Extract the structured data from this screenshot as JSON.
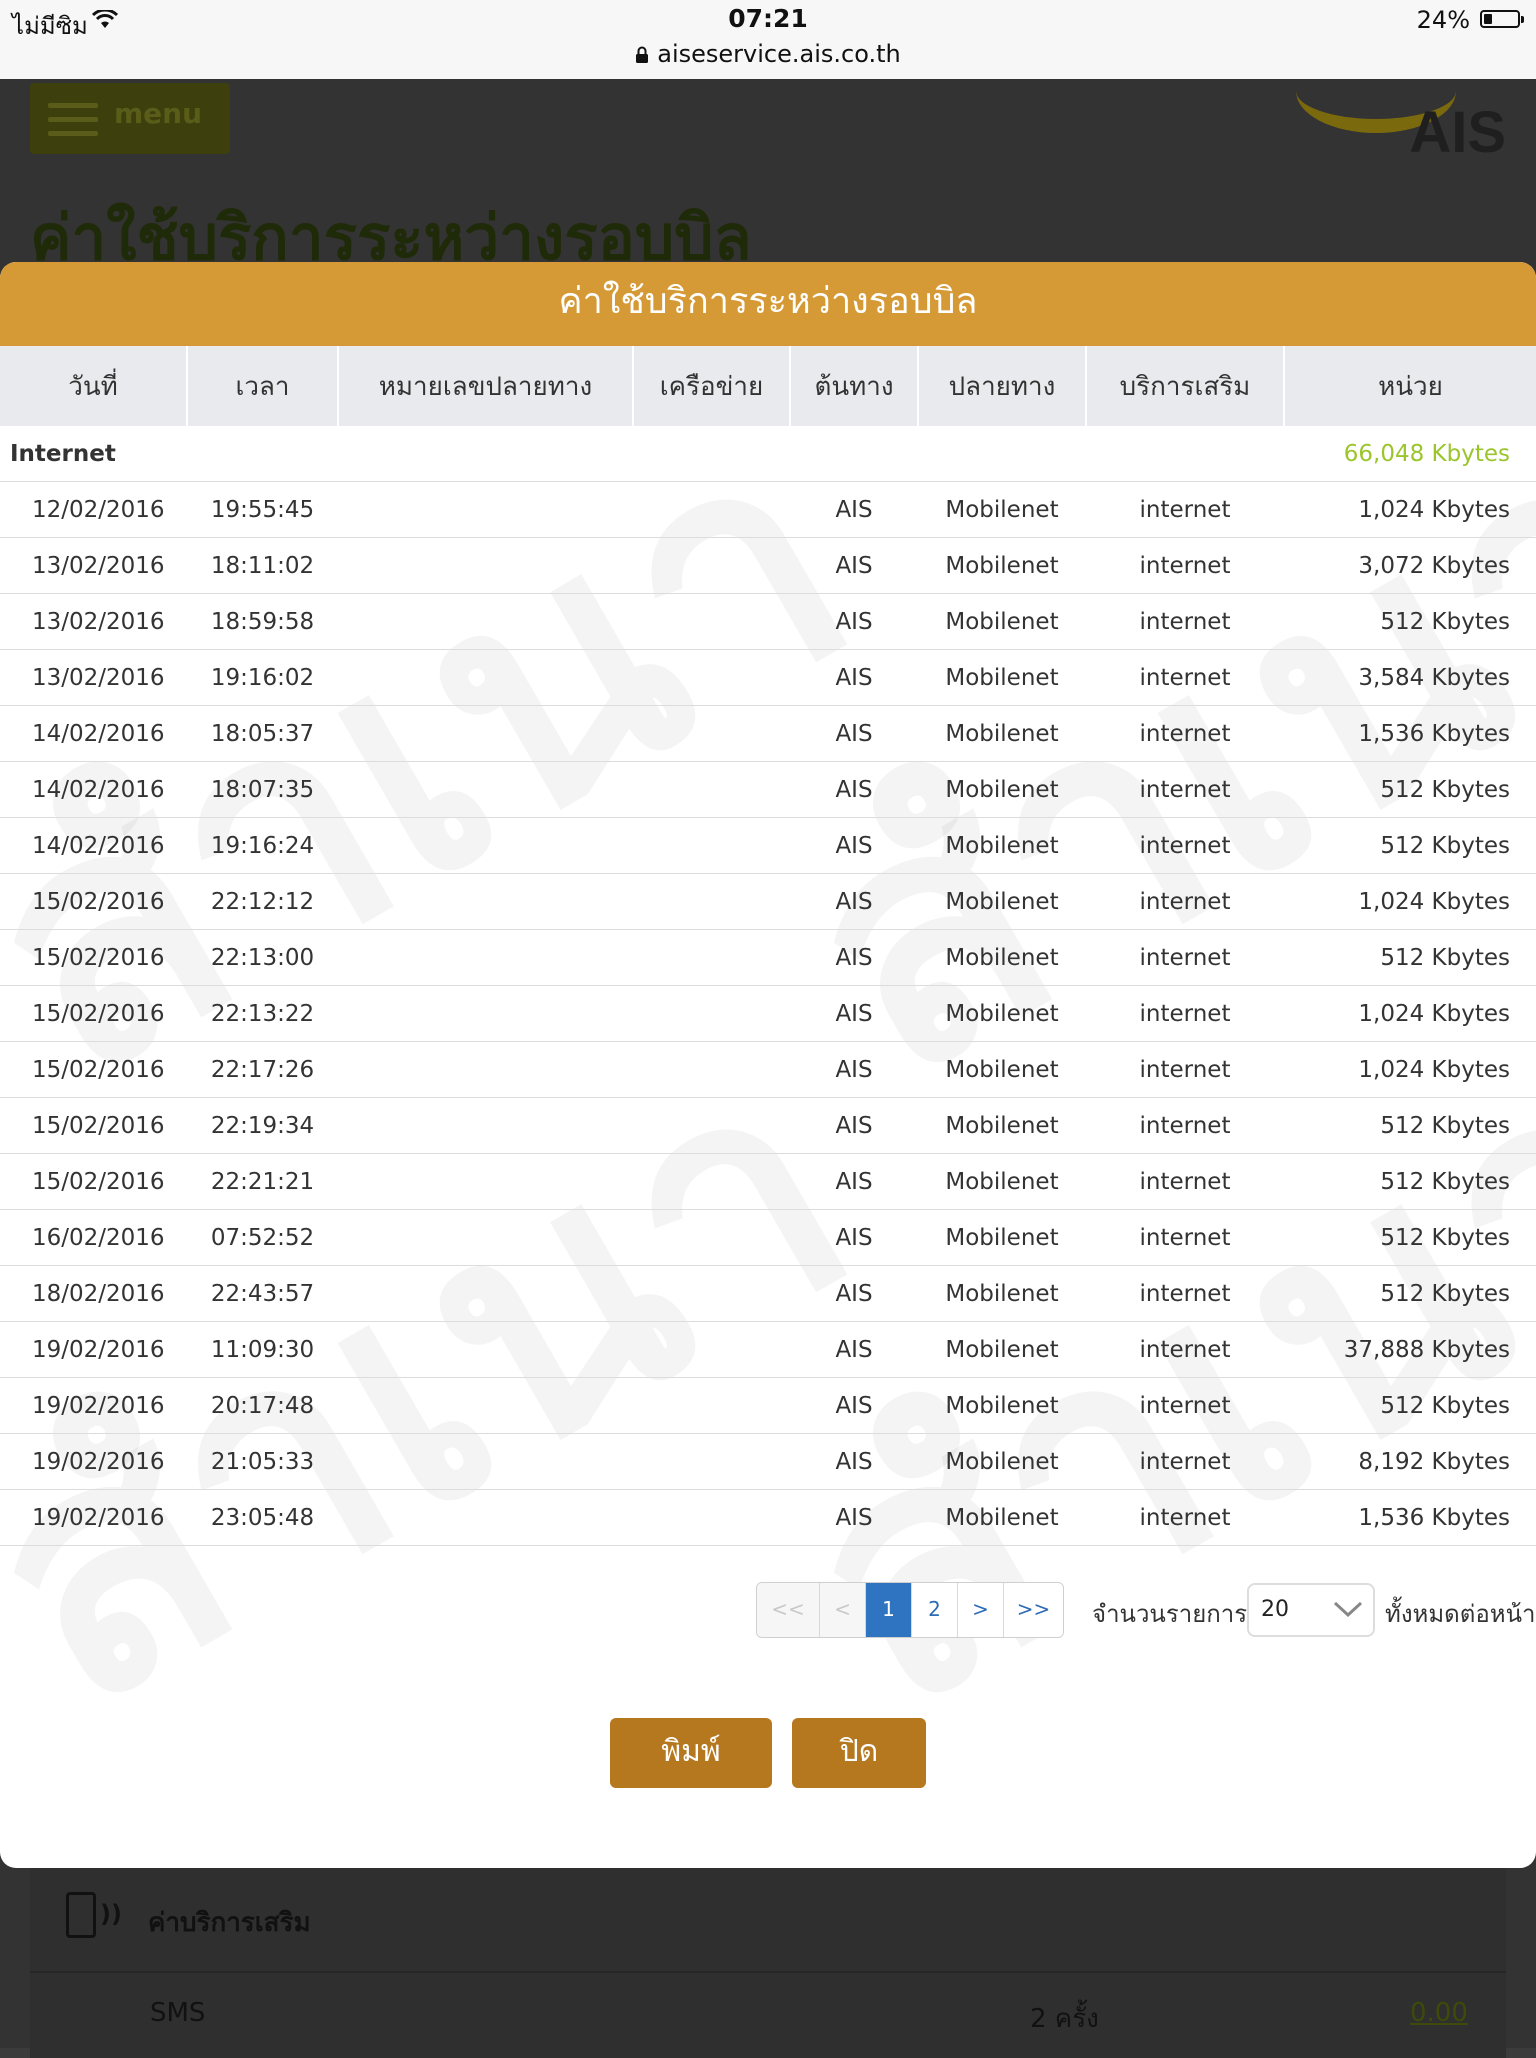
{
  "status_bar": {
    "carrier": "ไม่มีซิม",
    "time": "07:21",
    "url": "aiseservice.ais.co.th",
    "battery": "24%",
    "battery_level": 0.24
  },
  "background": {
    "menu_label": "menu",
    "logo_text": "AIS",
    "page_title": "ค่าใช้บริการระหว่างรอบบิล",
    "section_title": "ค่าบริการเสริม",
    "row_label": "SMS",
    "row_count": "2 ครั้ง",
    "row_amount": "0.00"
  },
  "modal": {
    "title": "ค่าใช้บริการระหว่างรอบบิล",
    "watermark": "สำเนา",
    "columns": [
      "วันที่",
      "เวลา",
      "หมายเลขปลายทาง",
      "เครือข่าย",
      "ต้นทาง",
      "ปลายทาง",
      "บริการเสริม",
      "หน่วย"
    ],
    "group": {
      "label": "Internet",
      "total": "66,048 Kbytes"
    },
    "rows": [
      {
        "date": "12/02/2016",
        "time": "19:55:45",
        "dest_number": "",
        "network": "",
        "origin": "AIS",
        "destination": "Mobilenet",
        "service": "internet",
        "unit": "1,024 Kbytes"
      },
      {
        "date": "13/02/2016",
        "time": "18:11:02",
        "dest_number": "",
        "network": "",
        "origin": "AIS",
        "destination": "Mobilenet",
        "service": "internet",
        "unit": "3,072 Kbytes"
      },
      {
        "date": "13/02/2016",
        "time": "18:59:58",
        "dest_number": "",
        "network": "",
        "origin": "AIS",
        "destination": "Mobilenet",
        "service": "internet",
        "unit": "512 Kbytes"
      },
      {
        "date": "13/02/2016",
        "time": "19:16:02",
        "dest_number": "",
        "network": "",
        "origin": "AIS",
        "destination": "Mobilenet",
        "service": "internet",
        "unit": "3,584 Kbytes"
      },
      {
        "date": "14/02/2016",
        "time": "18:05:37",
        "dest_number": "",
        "network": "",
        "origin": "AIS",
        "destination": "Mobilenet",
        "service": "internet",
        "unit": "1,536 Kbytes"
      },
      {
        "date": "14/02/2016",
        "time": "18:07:35",
        "dest_number": "",
        "network": "",
        "origin": "AIS",
        "destination": "Mobilenet",
        "service": "internet",
        "unit": "512 Kbytes"
      },
      {
        "date": "14/02/2016",
        "time": "19:16:24",
        "dest_number": "",
        "network": "",
        "origin": "AIS",
        "destination": "Mobilenet",
        "service": "internet",
        "unit": "512 Kbytes"
      },
      {
        "date": "15/02/2016",
        "time": "22:12:12",
        "dest_number": "",
        "network": "",
        "origin": "AIS",
        "destination": "Mobilenet",
        "service": "internet",
        "unit": "1,024 Kbytes"
      },
      {
        "date": "15/02/2016",
        "time": "22:13:00",
        "dest_number": "",
        "network": "",
        "origin": "AIS",
        "destination": "Mobilenet",
        "service": "internet",
        "unit": "512 Kbytes"
      },
      {
        "date": "15/02/2016",
        "time": "22:13:22",
        "dest_number": "",
        "network": "",
        "origin": "AIS",
        "destination": "Mobilenet",
        "service": "internet",
        "unit": "1,024 Kbytes"
      },
      {
        "date": "15/02/2016",
        "time": "22:17:26",
        "dest_number": "",
        "network": "",
        "origin": "AIS",
        "destination": "Mobilenet",
        "service": "internet",
        "unit": "1,024 Kbytes"
      },
      {
        "date": "15/02/2016",
        "time": "22:19:34",
        "dest_number": "",
        "network": "",
        "origin": "AIS",
        "destination": "Mobilenet",
        "service": "internet",
        "unit": "512 Kbytes"
      },
      {
        "date": "15/02/2016",
        "time": "22:21:21",
        "dest_number": "",
        "network": "",
        "origin": "AIS",
        "destination": "Mobilenet",
        "service": "internet",
        "unit": "512 Kbytes"
      },
      {
        "date": "16/02/2016",
        "time": "07:52:52",
        "dest_number": "",
        "network": "",
        "origin": "AIS",
        "destination": "Mobilenet",
        "service": "internet",
        "unit": "512 Kbytes"
      },
      {
        "date": "18/02/2016",
        "time": "22:43:57",
        "dest_number": "",
        "network": "",
        "origin": "AIS",
        "destination": "Mobilenet",
        "service": "internet",
        "unit": "512 Kbytes"
      },
      {
        "date": "19/02/2016",
        "time": "11:09:30",
        "dest_number": "",
        "network": "",
        "origin": "AIS",
        "destination": "Mobilenet",
        "service": "internet",
        "unit": "37,888 Kbytes"
      },
      {
        "date": "19/02/2016",
        "time": "20:17:48",
        "dest_number": "",
        "network": "",
        "origin": "AIS",
        "destination": "Mobilenet",
        "service": "internet",
        "unit": "512 Kbytes"
      },
      {
        "date": "19/02/2016",
        "time": "21:05:33",
        "dest_number": "",
        "network": "",
        "origin": "AIS",
        "destination": "Mobilenet",
        "service": "internet",
        "unit": "8,192 Kbytes"
      },
      {
        "date": "19/02/2016",
        "time": "23:05:48",
        "dest_number": "",
        "network": "",
        "origin": "AIS",
        "destination": "Mobilenet",
        "service": "internet",
        "unit": "1,536 Kbytes"
      }
    ],
    "pagination": {
      "first": "<<",
      "prev": "<",
      "pages": [
        "1",
        "2"
      ],
      "current": "1",
      "next": ">",
      "last": ">>"
    },
    "per_page_label": "จำนวนรายการ",
    "per_page_value": "20",
    "per_page_tail": "ทั้งหมดต่อหน้า",
    "print_label": "พิมพ์",
    "close_label": "ปิด"
  },
  "colors": {
    "header_orange": "#d59a36",
    "button_brown": "#b5781f",
    "internet_green": "#9bc52b",
    "active_page_blue": "#2f74c0"
  }
}
